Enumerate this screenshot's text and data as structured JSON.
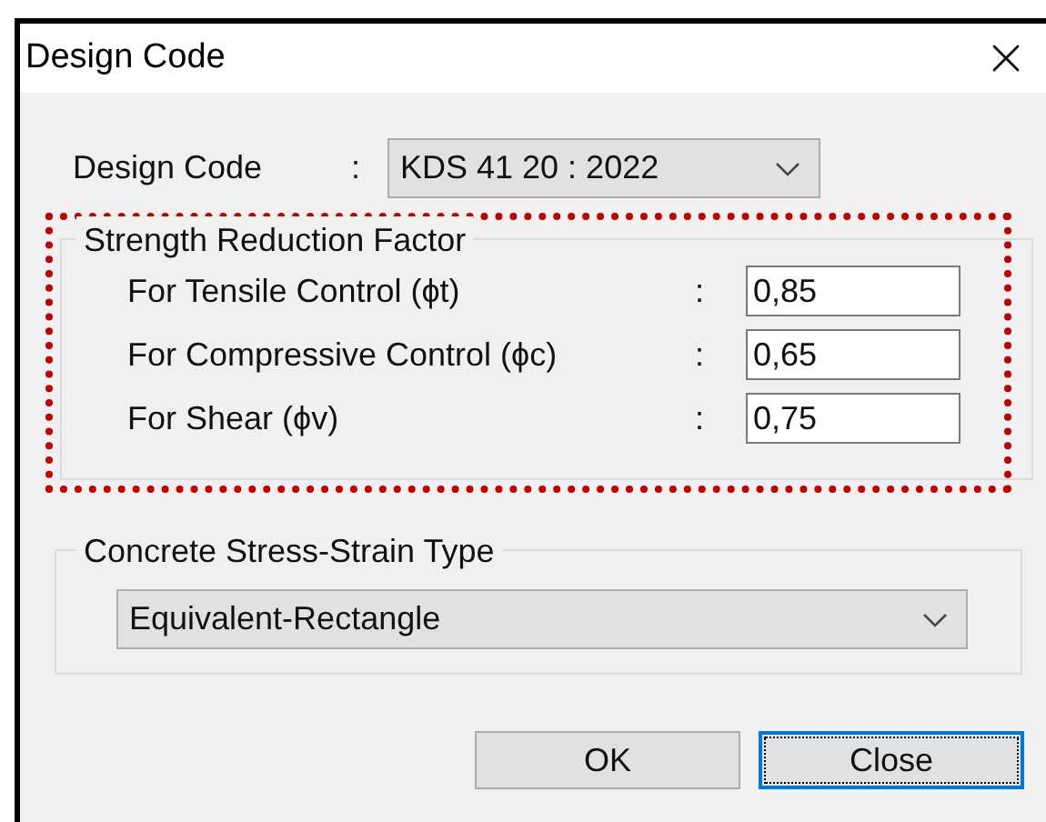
{
  "window": {
    "title": "Design Code"
  },
  "design_code": {
    "label": "Design Code",
    "separator": ":",
    "value": "KDS 41 20 : 2022"
  },
  "strength_reduction": {
    "title": "Strength Reduction Factor",
    "rows": [
      {
        "label": "For Tensile Control (ϕt)",
        "separator": ":",
        "value": "0,85"
      },
      {
        "label": "For Compressive Control (ϕc)",
        "separator": ":",
        "value": "0,65"
      },
      {
        "label": "For Shear (ϕv)",
        "separator": ":",
        "value": "0,75"
      }
    ]
  },
  "stress_strain": {
    "title": "Concrete Stress-Strain Type",
    "value": "Equivalent-Rectangle"
  },
  "buttons": [
    {
      "label": "OK",
      "focused": false
    },
    {
      "label": "Close",
      "focused": true
    }
  ]
}
